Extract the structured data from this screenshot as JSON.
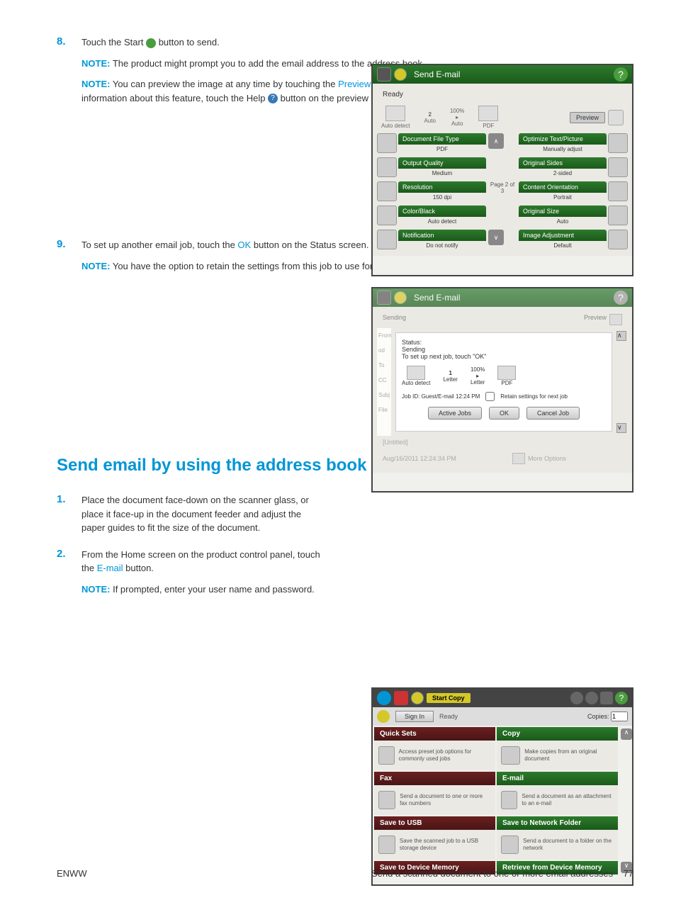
{
  "steps": {
    "s8": {
      "num": "8.",
      "text": "Touch the Start ",
      "text2": " button to send.",
      "note1": "The product might prompt you to add the email address to the address book.",
      "note2a": "You can preview the image at any time by touching the ",
      "note2link": "Preview",
      "note2b": " button in the upper-right corner of the screen. For more information about this feature, touch the Help ",
      "note2c": " button on the preview screen."
    },
    "s9": {
      "num": "9.",
      "text": "To set up another email job, touch the ",
      "link": "OK",
      "text2": " button on the Status screen.",
      "note": "You have the option to retain the settings from this job to use for the next job."
    },
    "s1": {
      "num": "1.",
      "text": "Place the document face-down on the scanner glass, or place it face-up in the document feeder and adjust the paper guides to fit the size of the document."
    },
    "s2": {
      "num": "2.",
      "text": "From the Home screen on the product control panel, touch the ",
      "link": "E-mail",
      "text2": " button.",
      "note": "If prompted, enter your user name and password."
    }
  },
  "noteLabel": "NOTE:",
  "sectionTitle": "Send email by using the address book",
  "ss1": {
    "title": "Send E-mail",
    "ready": "Ready",
    "pct": "100%",
    "count": "2",
    "autoDetect": "Auto detect",
    "auto": "Auto",
    "pdf": "PDF",
    "preview": "Preview",
    "opts": [
      {
        "l": "Document File Type",
        "v": "PDF"
      },
      {
        "l": "Optimize Text/Picture",
        "v": "Manually adjust"
      },
      {
        "l": "Output Quality",
        "v": "Medium"
      },
      {
        "l": "Original Sides",
        "v": "2-sided"
      },
      {
        "l": "Resolution",
        "v": "150 dpi"
      },
      {
        "l": "Content Orientation",
        "v": "Portrait"
      },
      {
        "l": "Color/Black",
        "v": "Auto detect"
      },
      {
        "l": "Original Size",
        "v": "Auto"
      },
      {
        "l": "Notification",
        "v": "Do not notify"
      },
      {
        "l": "Image Adjustment",
        "v": "Default"
      }
    ],
    "pageInd": "Page 2 of 3"
  },
  "ss2": {
    "title": "Send E-mail",
    "sending": "Sending",
    "preview": "Preview",
    "labels": {
      "from": "From",
      "to": "To",
      "cc": "CC",
      "sub": "Subj",
      "file": "File"
    },
    "status": "Status:",
    "statusVal": "Sending",
    "statusLine": "To set up next job, touch \"OK\"",
    "pct": "100%",
    "count": "1",
    "autoDetect": "Auto detect",
    "letter": "Letter",
    "pdf": "PDF",
    "jobId": "Job ID: Guest/E-mail 12:24 PM",
    "retain": "Retain settings for next job",
    "btns": {
      "active": "Active Jobs",
      "ok": "OK",
      "cancel": "Cancel Job"
    },
    "untitled": "[Untitled]",
    "time": "Aug/16/2011 12:24:34 PM",
    "more": "More Options"
  },
  "ss3": {
    "title": "Start Copy",
    "signIn": "Sign In",
    "ready": "Ready",
    "copies": "Copies:",
    "copiesVal": "1",
    "apps": [
      {
        "h": "Quick Sets",
        "t": "Access preset job options for commonly used jobs",
        "c": "red"
      },
      {
        "h": "Copy",
        "t": "Make copies from an original document",
        "c": "green"
      },
      {
        "h": "Fax",
        "t": "Send a document to one or more fax numbers",
        "c": "red"
      },
      {
        "h": "E-mail",
        "t": "Send a document as an attachment to an e-mail",
        "c": "green"
      },
      {
        "h": "Save to USB",
        "t": "Save the scanned job to a USB storage device",
        "c": "red"
      },
      {
        "h": "Save to Network Folder",
        "t": "Send a document to a folder on the network",
        "c": "green"
      },
      {
        "h": "Save to Device Memory",
        "t": "",
        "c": "red"
      },
      {
        "h": "Retrieve from Device Memory",
        "t": "",
        "c": "green"
      }
    ]
  },
  "footer": {
    "left": "ENWW",
    "right": "Send a scanned document to one or more email addresses",
    "page": "77"
  }
}
